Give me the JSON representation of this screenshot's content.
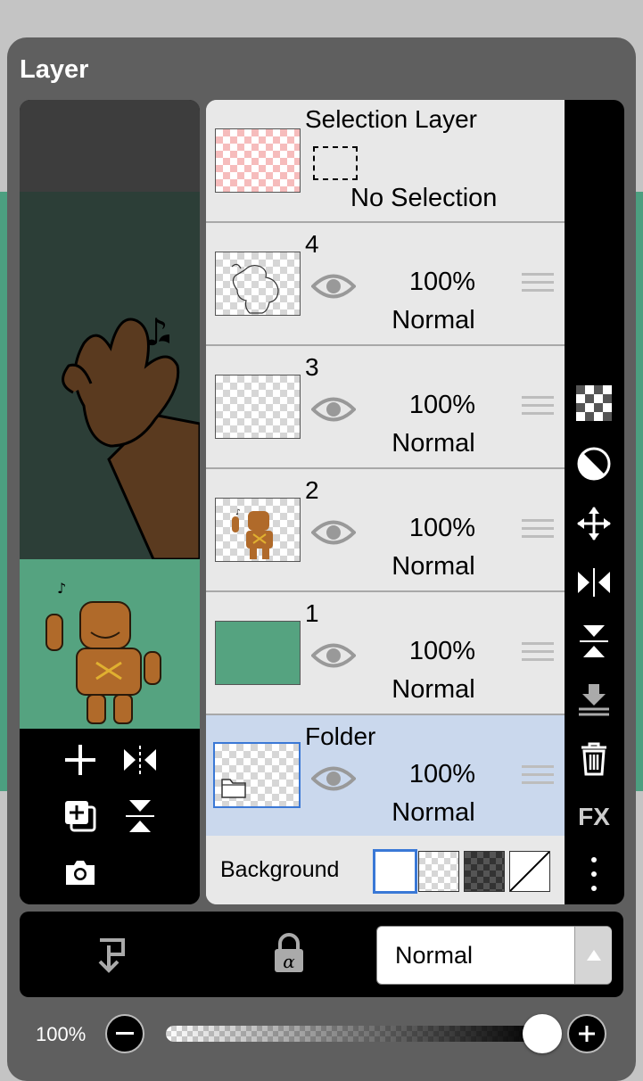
{
  "dialog": {
    "title": "Layer"
  },
  "selection_layer": {
    "name": "Selection Layer",
    "status": "No Selection"
  },
  "layers": [
    {
      "name": "4",
      "opacity": "100%",
      "blend": "Normal",
      "visible": true
    },
    {
      "name": "3",
      "opacity": "100%",
      "blend": "Normal",
      "visible": true
    },
    {
      "name": "2",
      "opacity": "100%",
      "blend": "Normal",
      "visible": true
    },
    {
      "name": "1",
      "opacity": "100%",
      "blend": "Normal",
      "visible": true,
      "fill_color": "#55a380"
    },
    {
      "name": "Folder",
      "opacity": "100%",
      "blend": "Normal",
      "visible": true,
      "selected": true
    }
  ],
  "background": {
    "label": "Background",
    "options": [
      "white",
      "transparent",
      "dark-checker",
      "none"
    ],
    "selected": "white"
  },
  "right_tools": [
    "checker-icon",
    "contrast-icon",
    "move-icon",
    "flip-horizontal-icon",
    "flip-vertical-icon",
    "merge-down-icon",
    "trash-icon",
    "fx-icon",
    "more-vertical-icon"
  ],
  "right_tools_fx_label": "FX",
  "preview_tools": [
    "add-layer-icon",
    "flip-horizontal-icon",
    "duplicate-layer-icon",
    "flip-vertical-icon",
    "camera-icon"
  ],
  "bottom_bar": {
    "blend_mode": "Normal",
    "clip_icon": "clipping-arrow-icon",
    "lock_icon": "alpha-lock-icon"
  },
  "opacity": {
    "label": "100%",
    "value": 1.0
  },
  "colors": {
    "accent": "#4c9f80",
    "selected_row": "#cad8ed",
    "selection_border": "#3a78d6"
  }
}
